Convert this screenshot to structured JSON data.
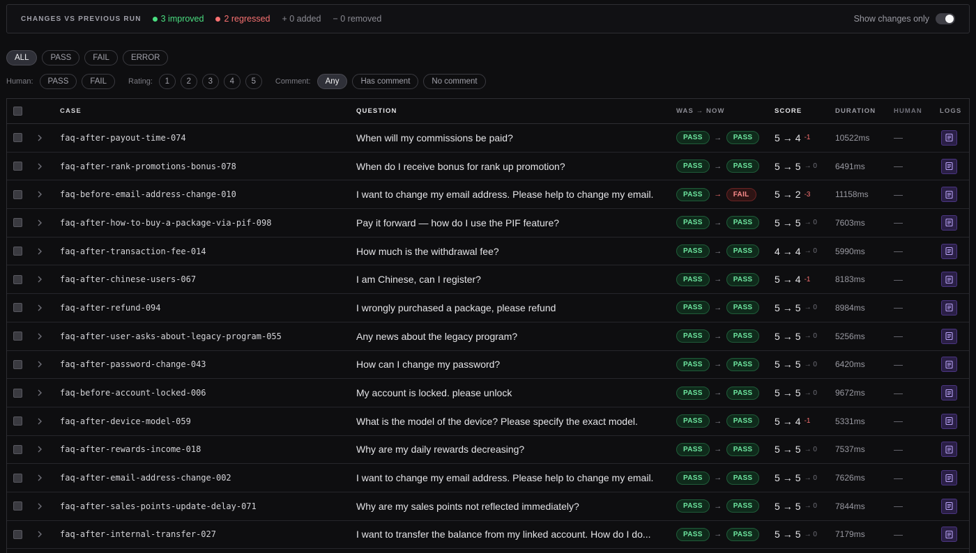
{
  "changes": {
    "title": "CHANGES VS PREVIOUS RUN",
    "improved": "3 improved",
    "regressed": "2 regressed",
    "added": "+ 0 added",
    "removed": "− 0 removed",
    "toggle_label": "Show changes only",
    "toggle_on": false,
    "colors": {
      "improved": "#4ade80",
      "regressed": "#f87171"
    }
  },
  "status_filters": [
    "ALL",
    "PASS",
    "FAIL",
    "ERROR"
  ],
  "status_active": "ALL",
  "sub_filters": {
    "human_label": "Human:",
    "human": [
      "PASS",
      "FAIL"
    ],
    "rating_label": "Rating:",
    "rating": [
      "1",
      "2",
      "3",
      "4",
      "5"
    ],
    "comment_label": "Comment:",
    "comment": [
      "Any",
      "Has comment",
      "No comment"
    ],
    "comment_active": "Any"
  },
  "columns": {
    "case": "CASE",
    "question": "QUESTION",
    "was_now": "WAS → NOW",
    "score": "SCORE",
    "duration": "DURATION",
    "human": "HUMAN",
    "logs": "LOGS"
  },
  "icons": {
    "expand": "chevron-right-icon",
    "logs": "log-file-icon",
    "arrow": "arrow-right-icon"
  },
  "rows": [
    {
      "case": "faq-after-payout-time-074",
      "question": "When will my commissions be paid?",
      "was": "PASS",
      "now": "PASS",
      "score_prev": "5",
      "score_now": "4",
      "delta": "-1",
      "duration": "10522ms",
      "human": "—"
    },
    {
      "case": "faq-after-rank-promotions-bonus-078",
      "question": "When do I receive bonus for rank up promotion?",
      "was": "PASS",
      "now": "PASS",
      "score_prev": "5",
      "score_now": "5",
      "delta": "→ 0",
      "duration": "6491ms",
      "human": "—"
    },
    {
      "case": "faq-before-email-address-change-010",
      "question": "I want to change my email address. Please help to change my email.",
      "was": "PASS",
      "now": "FAIL",
      "score_prev": "5",
      "score_now": "2",
      "delta": "-3",
      "duration": "11158ms",
      "human": "—"
    },
    {
      "case": "faq-after-how-to-buy-a-package-via-pif-098",
      "question": "Pay it forward — how do I use the PIF feature?",
      "was": "PASS",
      "now": "PASS",
      "score_prev": "5",
      "score_now": "5",
      "delta": "→ 0",
      "duration": "7603ms",
      "human": "—"
    },
    {
      "case": "faq-after-transaction-fee-014",
      "question": "How much is the withdrawal fee?",
      "was": "PASS",
      "now": "PASS",
      "score_prev": "4",
      "score_now": "4",
      "delta": "→ 0",
      "duration": "5990ms",
      "human": "—"
    },
    {
      "case": "faq-after-chinese-users-067",
      "question": "I am Chinese, can I register?",
      "was": "PASS",
      "now": "PASS",
      "score_prev": "5",
      "score_now": "4",
      "delta": "-1",
      "duration": "8183ms",
      "human": "—"
    },
    {
      "case": "faq-after-refund-094",
      "question": "I wrongly purchased a package, please refund",
      "was": "PASS",
      "now": "PASS",
      "score_prev": "5",
      "score_now": "5",
      "delta": "→ 0",
      "duration": "8984ms",
      "human": "—"
    },
    {
      "case": "faq-after-user-asks-about-legacy-program-055",
      "question": "Any news about the legacy program?",
      "was": "PASS",
      "now": "PASS",
      "score_prev": "5",
      "score_now": "5",
      "delta": "→ 0",
      "duration": "5256ms",
      "human": "—"
    },
    {
      "case": "faq-after-password-change-043",
      "question": "How can I change my password?",
      "was": "PASS",
      "now": "PASS",
      "score_prev": "5",
      "score_now": "5",
      "delta": "→ 0",
      "duration": "6420ms",
      "human": "—"
    },
    {
      "case": "faq-before-account-locked-006",
      "question": "My account is locked. please unlock",
      "was": "PASS",
      "now": "PASS",
      "score_prev": "5",
      "score_now": "5",
      "delta": "→ 0",
      "duration": "9672ms",
      "human": "—"
    },
    {
      "case": "faq-after-device-model-059",
      "question": "What is the model of the device? Please specify the exact model.",
      "was": "PASS",
      "now": "PASS",
      "score_prev": "5",
      "score_now": "4",
      "delta": "-1",
      "duration": "5331ms",
      "human": "—"
    },
    {
      "case": "faq-after-rewards-income-018",
      "question": "Why are my daily rewards decreasing?",
      "was": "PASS",
      "now": "PASS",
      "score_prev": "5",
      "score_now": "5",
      "delta": "→ 0",
      "duration": "7537ms",
      "human": "—"
    },
    {
      "case": "faq-after-email-address-change-002",
      "question": "I want to change my email address. Please help to change my email.",
      "was": "PASS",
      "now": "PASS",
      "score_prev": "5",
      "score_now": "5",
      "delta": "→ 0",
      "duration": "7626ms",
      "human": "—"
    },
    {
      "case": "faq-after-sales-points-update-delay-071",
      "question": "Why are my sales points not reflected immediately?",
      "was": "PASS",
      "now": "PASS",
      "score_prev": "5",
      "score_now": "5",
      "delta": "→ 0",
      "duration": "7844ms",
      "human": "—"
    },
    {
      "case": "faq-after-internal-transfer-027",
      "question": "I want to transfer the balance from my linked account. How do I do...",
      "was": "PASS",
      "now": "PASS",
      "score_prev": "5",
      "score_now": "5",
      "delta": "→ 0",
      "duration": "7179ms",
      "human": "—"
    }
  ]
}
